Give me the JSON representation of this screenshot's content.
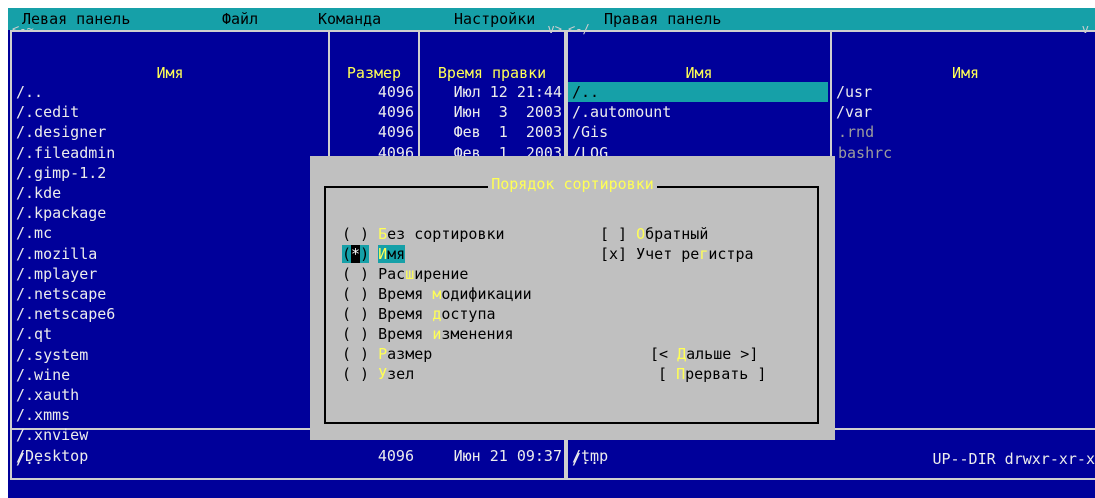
{
  "menu": {
    "left_panel": "Левая панель",
    "file": "Файл",
    "command": "Команда",
    "options": "Настройки",
    "right_panel": "Правая панель"
  },
  "left_panel": {
    "corner_left": "<-~",
    "corner_right": "v>",
    "headers": {
      "name": "Имя",
      "size": "Размер",
      "mtime": "Время правки"
    },
    "files": [
      {
        "name": "/..",
        "size": "4096",
        "mtime": "Июл 12 21:44"
      },
      {
        "name": "/.cedit",
        "size": "4096",
        "mtime": "Июн  3  2003"
      },
      {
        "name": "/.designer",
        "size": "4096",
        "mtime": "Фев  1  2003"
      },
      {
        "name": "/.fileadmin",
        "size": "4096",
        "mtime": "Фев  1  2003"
      },
      {
        "name": "/.gimp-1.2",
        "size": "",
        "mtime": ""
      },
      {
        "name": "/.kde",
        "size": "",
        "mtime": ""
      },
      {
        "name": "/.kpackage",
        "size": "",
        "mtime": ""
      },
      {
        "name": "/.mc",
        "size": "",
        "mtime": ""
      },
      {
        "name": "/.mozilla",
        "size": "",
        "mtime": ""
      },
      {
        "name": "/.mplayer",
        "size": "",
        "mtime": ""
      },
      {
        "name": "/.netscape",
        "size": "",
        "mtime": ""
      },
      {
        "name": "/.netscape6",
        "size": "",
        "mtime": ""
      },
      {
        "name": "/.qt",
        "size": "",
        "mtime": ""
      },
      {
        "name": "/.system",
        "size": "",
        "mtime": ""
      },
      {
        "name": "/.wine",
        "size": "",
        "mtime": ""
      },
      {
        "name": "/.xauth",
        "size": "",
        "mtime": ""
      },
      {
        "name": "/.xmms",
        "size": "",
        "mtime": ""
      },
      {
        "name": "/.xnview",
        "size": "",
        "mtime": ""
      },
      {
        "name": "/Desktop",
        "size": "4096",
        "mtime": "Июн 21 09:37"
      }
    ],
    "status": "/.."
  },
  "right_panel": {
    "corner_left": "<-/",
    "corner_right": "v",
    "headers": {
      "name1": "Имя",
      "name2": "Имя"
    },
    "col1": [
      "/..",
      "/.automount",
      "/Gis",
      "/LOG",
      "/tmp"
    ],
    "col2": [
      "/usr",
      "/var",
      ".rnd",
      "bashrc"
    ],
    "status_left": "/..",
    "status_right": "UP--DIR drwxr-xr-x"
  },
  "dialog": {
    "title": "Порядок сортировки",
    "options": [
      {
        "radio": "( )",
        "pre": "",
        "hot": "Б",
        "post": "ез сортировки"
      },
      {
        "radio": "(*)",
        "pre": "",
        "hot": "И",
        "post": "мя"
      },
      {
        "radio": "( )",
        "pre": "Рас",
        "hot": "ш",
        "post": "ирение"
      },
      {
        "radio": "( )",
        "pre": "Время ",
        "hot": "м",
        "post": "одификации"
      },
      {
        "radio": "( )",
        "pre": "Время ",
        "hot": "д",
        "post": "оступа"
      },
      {
        "radio": "( )",
        "pre": "Время ",
        "hot": "и",
        "post": "зменения"
      },
      {
        "radio": "( )",
        "pre": "",
        "hot": "Р",
        "post": "азмер"
      },
      {
        "radio": "( )",
        "pre": "",
        "hot": "У",
        "post": "зел"
      }
    ],
    "reverse": {
      "box": "[ ]",
      "hot": "О",
      "post": "братный"
    },
    "case": {
      "box": "[x]",
      "pre": "Учет ре",
      "hot": "г",
      "post": "истра"
    },
    "btn_next": {
      "pre": "[< ",
      "hot": "Д",
      "post": "альше >]"
    },
    "btn_abort": {
      "pre": "[ ",
      "hot": "П",
      "post": "рервать ]"
    }
  },
  "colors": {
    "background": "#00009a",
    "selection": "#16a0a8",
    "dialog": "#c0c0c0",
    "hotkey": "#ffff55",
    "text": "#ececec"
  }
}
